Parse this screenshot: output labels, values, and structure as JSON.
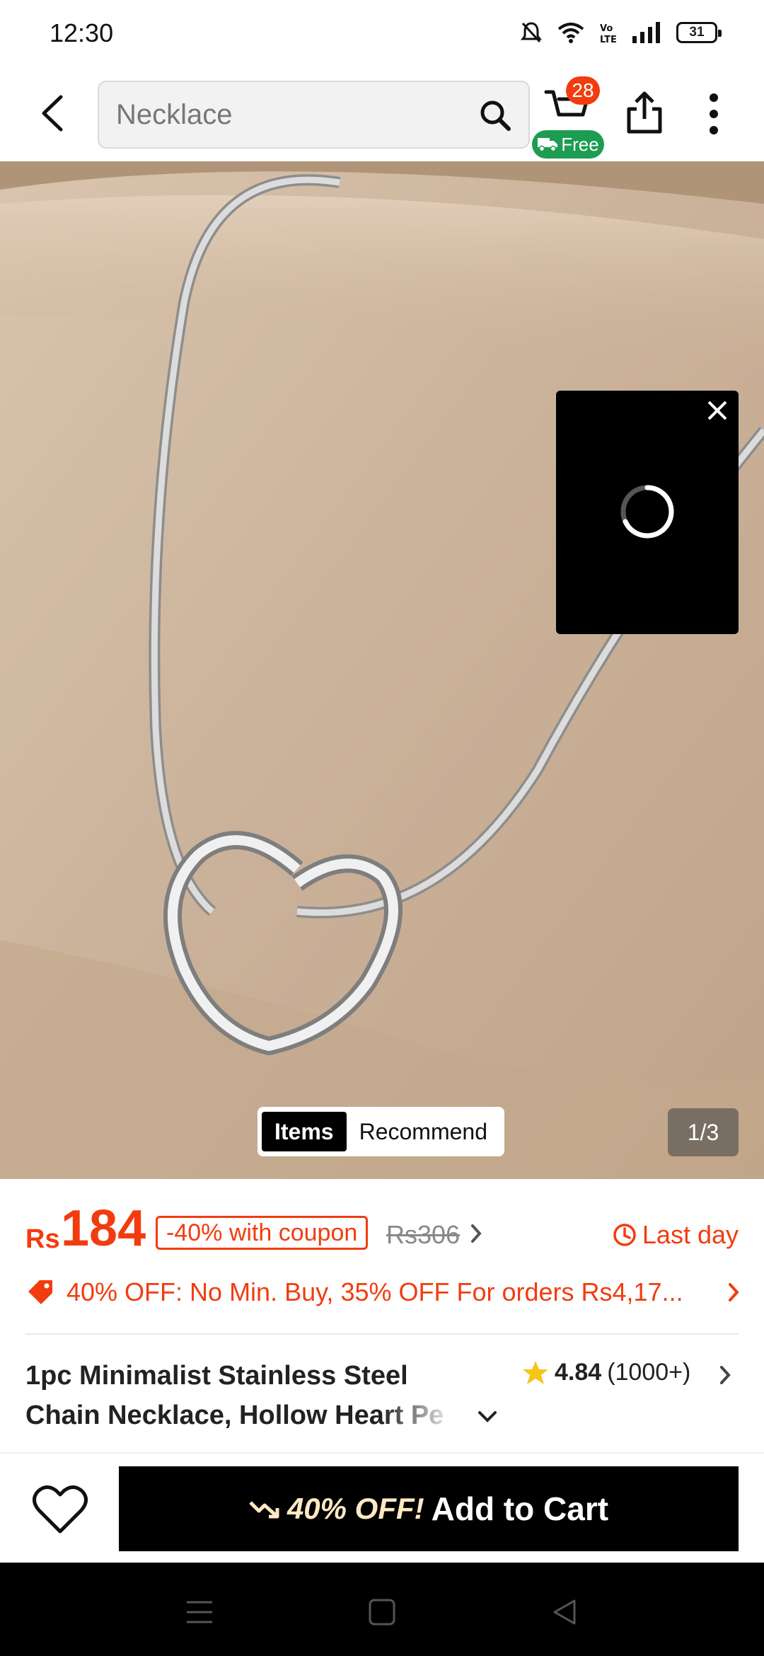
{
  "status_bar": {
    "time": "12:30",
    "battery": "31",
    "icons": [
      "mute-icon",
      "wifi-icon",
      "volte-icon",
      "signal-icon",
      "battery-icon"
    ]
  },
  "top_nav": {
    "search_placeholder": "Necklace",
    "cart_count": "28",
    "free_label": "Free"
  },
  "image_gallery": {
    "tabs": [
      "Items",
      "Recommend"
    ],
    "active_tab": "Items",
    "counter": "1/3"
  },
  "price": {
    "currency": "Rs",
    "current": "184",
    "coupon": "-40% with coupon",
    "original": "Rs306",
    "deadline": "Last day",
    "promo": "40% OFF: No Min. Buy,  35% OFF For orders Rs4,17..."
  },
  "product": {
    "title": "1pc Minimalist Stainless Steel Chain Necklace, Hollow Heart Pe",
    "rating": "4.84",
    "review_count": "(1000+)"
  },
  "action_bar": {
    "discount": "40% OFF!",
    "add_to_cart": "Add to Cart"
  },
  "colors": {
    "accent": "#f23c0f",
    "free_green": "#1e9c52",
    "star": "#f5c518"
  }
}
